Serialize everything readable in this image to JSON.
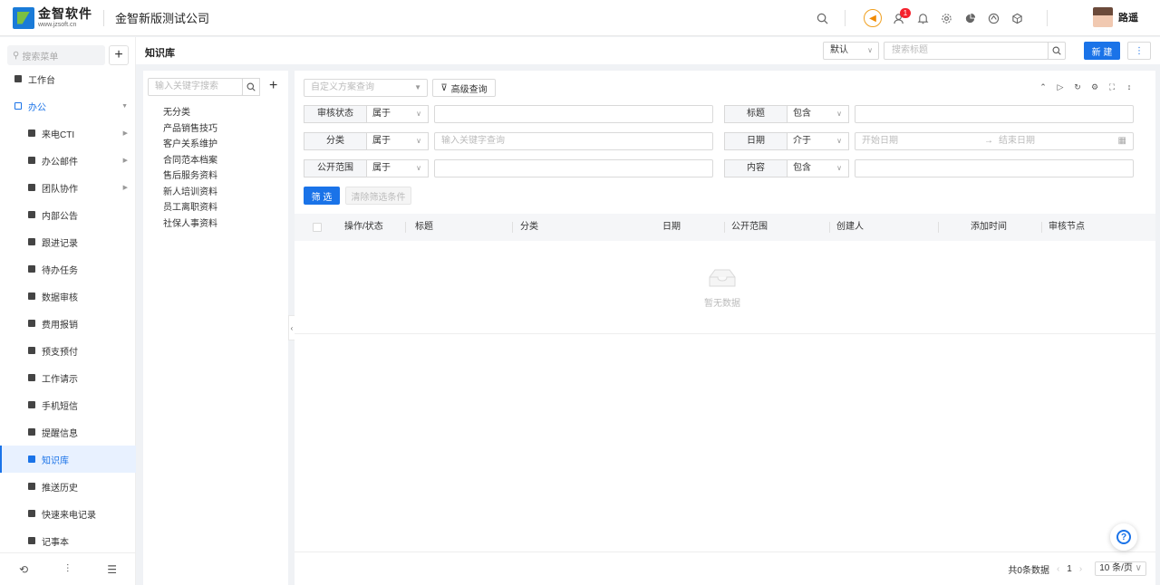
{
  "topbar": {
    "logo_name": "金智软件",
    "logo_url": "www.jzsoft.cn",
    "company": "金智新版测试公司",
    "notification_count": "1",
    "user_name": "路遥"
  },
  "sidebar": {
    "search_placeholder": "搜索菜单",
    "items": [
      {
        "label": "工作台"
      },
      {
        "label": "办公"
      },
      {
        "label": "来电CTI"
      },
      {
        "label": "办公邮件"
      },
      {
        "label": "团队协作"
      },
      {
        "label": "内部公告"
      },
      {
        "label": "跟进记录"
      },
      {
        "label": "待办任务"
      },
      {
        "label": "数据审核"
      },
      {
        "label": "费用报销"
      },
      {
        "label": "预支预付"
      },
      {
        "label": "工作请示"
      },
      {
        "label": "手机短信"
      },
      {
        "label": "提醒信息"
      },
      {
        "label": "知识库"
      },
      {
        "label": "推送历史"
      },
      {
        "label": "快速来电记录"
      },
      {
        "label": "记事本"
      }
    ]
  },
  "header": {
    "title": "知识库",
    "view_select": "默认",
    "search_placeholder": "搜索标题",
    "new_label": "新 建"
  },
  "categories": {
    "search_placeholder": "输入关键字搜索",
    "items": [
      "无分类",
      "产品销售技巧",
      "客户关系维护",
      "合同范本档案",
      "售后服务资料",
      "新人培训资料",
      "员工离职资料",
      "社保人事资料"
    ]
  },
  "filters": {
    "scheme_placeholder": "自定义方案查询",
    "advanced_label": "高级查询",
    "rows": [
      {
        "label": "审核状态",
        "op": "属于",
        "placeholder": ""
      },
      {
        "label": "分类",
        "op": "属于",
        "placeholder": "输入关键字查询"
      },
      {
        "label": "公开范围",
        "op": "属于",
        "placeholder": ""
      }
    ],
    "right_rows": [
      {
        "label": "标题",
        "op": "包含"
      },
      {
        "label": "日期",
        "op": "介于",
        "start": "开始日期",
        "end": "结束日期"
      },
      {
        "label": "内容",
        "op": "包含"
      }
    ],
    "filter_btn": "筛 选",
    "clear_btn": "清除筛选条件"
  },
  "table": {
    "columns": [
      "操作/状态",
      "标题",
      "分类",
      "日期",
      "公开范围",
      "创建人",
      "添加时间",
      "审核节点"
    ],
    "empty_text": "暂无数据"
  },
  "pager": {
    "total": "共0条数据",
    "page": "1",
    "page_size": "10 条/页"
  }
}
